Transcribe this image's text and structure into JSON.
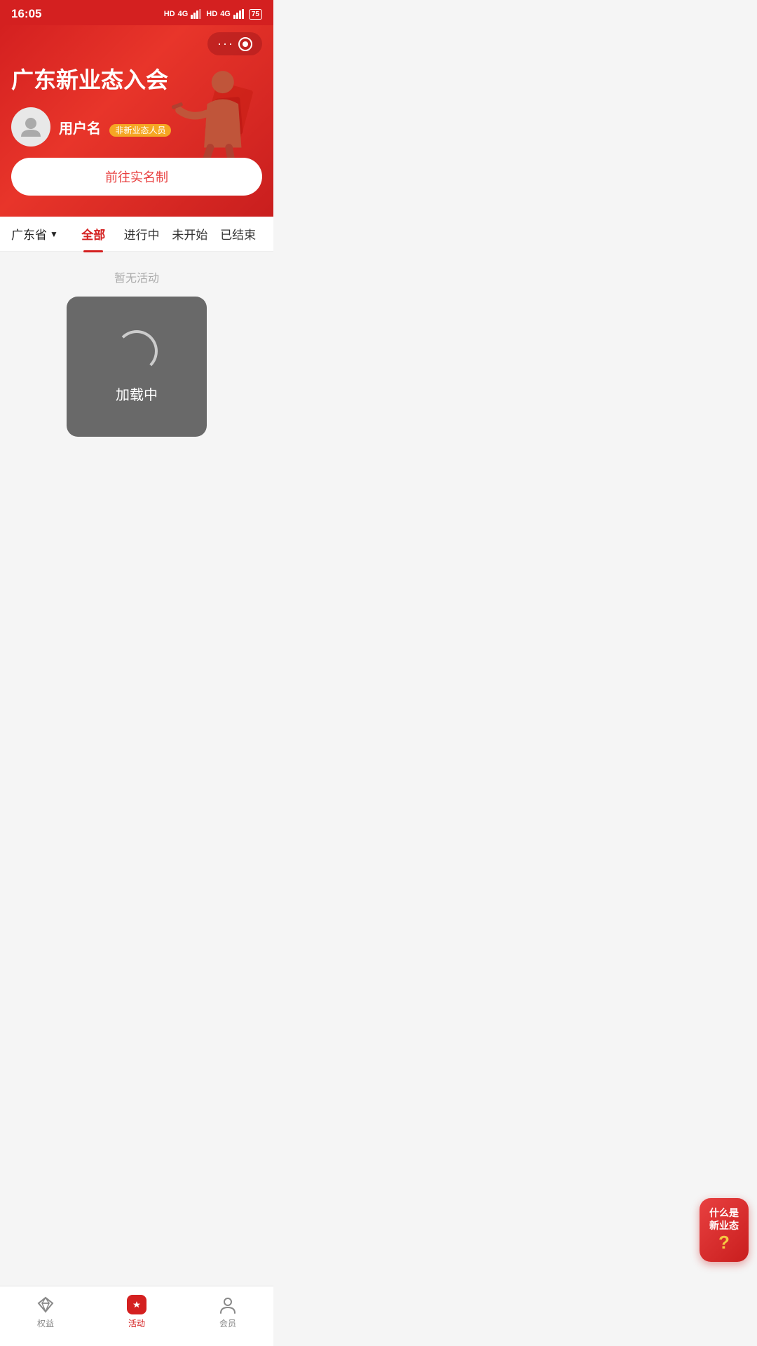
{
  "statusBar": {
    "time": "16:05",
    "batteryLevel": "75"
  },
  "header": {
    "title": "广东新业态入会",
    "recordBtn": {
      "dots": "···"
    }
  },
  "user": {
    "name": "用户名",
    "badge": "非新业态人员",
    "realnameBtn": "前往实名制"
  },
  "filterBar": {
    "province": "广东省",
    "tabs": [
      {
        "label": "全部",
        "active": true
      },
      {
        "label": "进行中",
        "active": false
      },
      {
        "label": "未开始",
        "active": false
      },
      {
        "label": "已结束",
        "active": false
      }
    ]
  },
  "content": {
    "emptyText": "暂无活动",
    "loadingText": "加载中"
  },
  "floatingBtn": {
    "line1": "什么是",
    "line2": "新业态",
    "question": "?"
  },
  "bottomNav": {
    "items": [
      {
        "label": "权益",
        "icon": "diamond-icon",
        "active": false
      },
      {
        "label": "活动",
        "icon": "star-icon",
        "active": true
      },
      {
        "label": "会员",
        "icon": "user-icon",
        "active": false
      }
    ]
  }
}
